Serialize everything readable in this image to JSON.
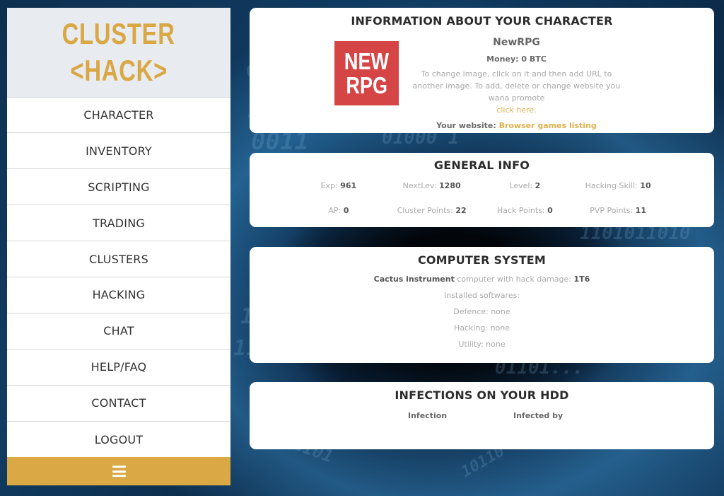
{
  "sidebar": {
    "logo": {
      "line1": "CLUSTER",
      "line2": "<HACK>"
    },
    "nav": [
      {
        "label": "CHARACTER"
      },
      {
        "label": "INVENTORY"
      },
      {
        "label": "SCRIPTING"
      },
      {
        "label": "TRADING"
      },
      {
        "label": "CLUSTERS"
      },
      {
        "label": "HACKING"
      },
      {
        "label": "CHAT"
      },
      {
        "label": "HELP/FAQ"
      },
      {
        "label": "CONTACT"
      },
      {
        "label": "LOGOUT"
      }
    ],
    "menu_icon": "hamburger-icon"
  },
  "character": {
    "title": "INFORMATION ABOUT YOUR CHARACTER",
    "image": {
      "line1": "NEW",
      "line2": "RPG"
    },
    "name": "NewRPG",
    "money_label": "Money:",
    "money_value": "0 BTC",
    "hint": "To change image, click on it and then add URL to another image. To add, delete or change website you wana promote",
    "hint_link": "click here.",
    "website_label": "Your website:",
    "website_link": "Browser games listing"
  },
  "general": {
    "title": "GENERAL INFO",
    "stats": [
      {
        "label": "Exp:",
        "value": "961"
      },
      {
        "label": "NextLev:",
        "value": "1280"
      },
      {
        "label": "Level:",
        "value": "2"
      },
      {
        "label": "Hacking Skill:",
        "value": "10"
      },
      {
        "label": "AP:",
        "value": "0"
      },
      {
        "label": "Cluster Points:",
        "value": "22"
      },
      {
        "label": "Hack Points:",
        "value": "0"
      },
      {
        "label": "PVP Points:",
        "value": "11"
      }
    ]
  },
  "system": {
    "title": "COMPUTER SYSTEM",
    "computer_name": "Cactus instrument",
    "computer_text": "computer with hack damage:",
    "hack_damage": "1T6",
    "installed_label": "Installed softwares:",
    "defence": "Defence: none",
    "hacking": "Hacking: none",
    "utility": "Utility: none"
  },
  "infections": {
    "title": "INFECTIONS ON YOUR HDD",
    "col_infection": "Infection",
    "col_infected_by": "Infected by"
  },
  "colors": {
    "accent": "#daa945",
    "logo": "#d9a743",
    "image_bg": "#d64545",
    "link": "#e0b04e"
  }
}
